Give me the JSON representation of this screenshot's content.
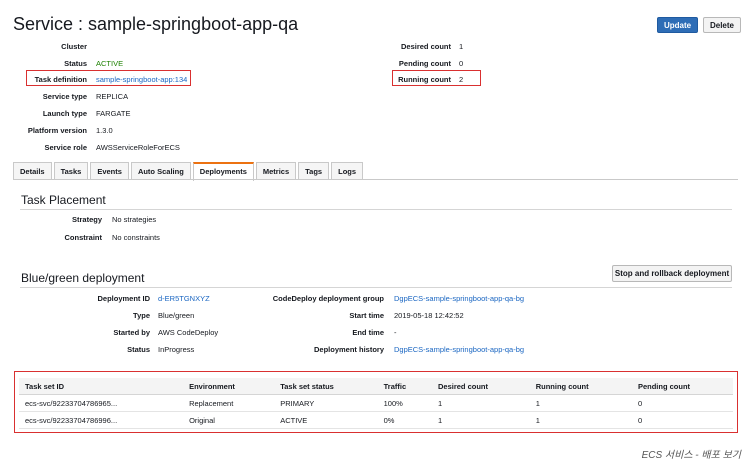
{
  "header": {
    "title": "Service : sample-springboot-app-qa",
    "update_label": "Update",
    "delete_label": "Delete"
  },
  "details_left": [
    {
      "label": "Cluster",
      "value": ""
    },
    {
      "label": "Status",
      "value": "ACTIVE"
    },
    {
      "label": "Task definition",
      "value": "sample-springboot-app:134"
    },
    {
      "label": "Service type",
      "value": "REPLICA"
    },
    {
      "label": "Launch type",
      "value": "FARGATE"
    },
    {
      "label": "Platform version",
      "value": "1.3.0"
    },
    {
      "label": "Service role",
      "value": "AWSServiceRoleForECS"
    }
  ],
  "details_right": [
    {
      "label": "Desired count",
      "value": "1"
    },
    {
      "label": "Pending count",
      "value": "0"
    },
    {
      "label": "Running count",
      "value": "2"
    }
  ],
  "tabs": [
    "Details",
    "Tasks",
    "Events",
    "Auto Scaling",
    "Deployments",
    "Metrics",
    "Tags",
    "Logs"
  ],
  "active_tab": "Deployments",
  "task_placement": {
    "heading": "Task Placement",
    "strategy_label": "Strategy",
    "strategy_value": "No strategies",
    "constraint_label": "Constraint",
    "constraint_value": "No constraints"
  },
  "blue_green": {
    "heading": "Blue/green deployment",
    "stop_button_label": "Stop and rollback deployment",
    "deployment_id_label": "Deployment ID",
    "deployment_id_value": "d-ER5TGNXYZ",
    "type_label": "Type",
    "type_value": "Blue/green",
    "started_by_label": "Started by",
    "started_by_value": "AWS CodeDeploy",
    "status_label": "Status",
    "status_value": "InProgress",
    "group_label": "CodeDeploy deployment group",
    "group_value": "DgpECS-sample-springboot-app-qa-bg",
    "start_time_label": "Start time",
    "start_time_value": "2019-05-18 12:42:52",
    "end_time_label": "End time",
    "end_time_value": "-",
    "history_label": "Deployment history",
    "history_value": "DgpECS-sample-springboot-app-qa-bg"
  },
  "task_sets": {
    "columns": [
      "Task set ID",
      "Environment",
      "Task set status",
      "Traffic",
      "Desired count",
      "Running count",
      "Pending count"
    ],
    "rows": [
      [
        "ecs-svc/92233704786965...",
        "Replacement",
        "PRIMARY",
        "100%",
        "1",
        "1",
        "0"
      ],
      [
        "ecs-svc/92233704786996...",
        "Original",
        "ACTIVE",
        "0%",
        "1",
        "1",
        "0"
      ]
    ]
  },
  "caption": "ECS 서비스 - 배포 보기",
  "colors": {
    "accent": "#2e6db6",
    "status_active": "#1d8102",
    "link": "#1a66c2",
    "highlight_box": "#d93030",
    "active_tab_border": "#ec7211"
  }
}
